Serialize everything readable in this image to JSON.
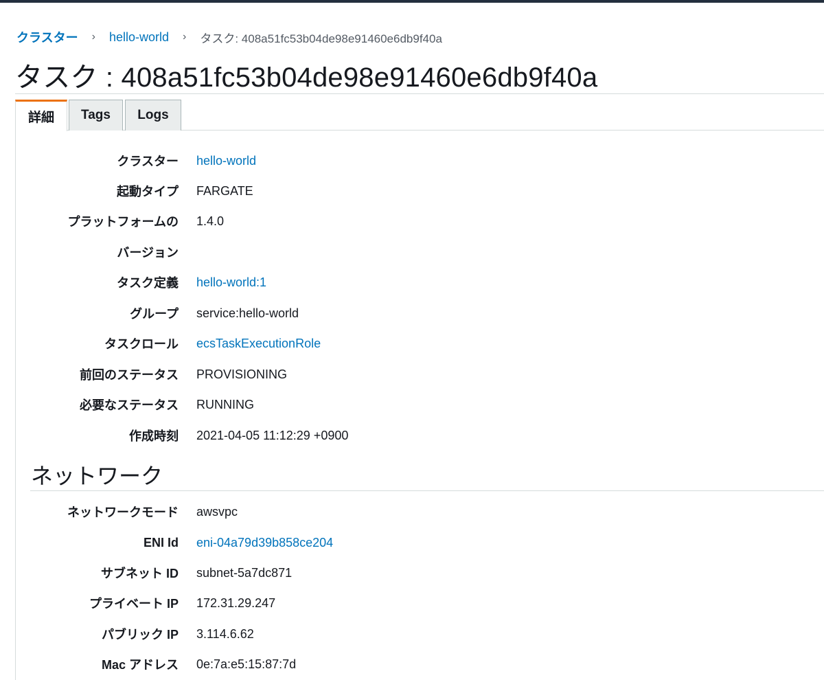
{
  "breadcrumb": {
    "items": [
      "クラスター",
      "hello-world"
    ],
    "current": "タスク: 408a51fc53b04de98e91460e6db9f40a",
    "separator": "›"
  },
  "page_title": "タスク : 408a51fc53b04de98e91460e6db9f40a",
  "tabs": [
    "詳細",
    "Tags",
    "Logs"
  ],
  "details": {
    "rows": [
      {
        "label": "クラスター",
        "value": "hello-world"
      },
      {
        "label": "起動タイプ",
        "value": "FARGATE"
      },
      {
        "label": "プラットフォームの",
        "value": "1.4.0"
      },
      {
        "label": "バージョン",
        "value": ""
      },
      {
        "label": "タスク定義",
        "value": "hello-world:1"
      },
      {
        "label": "グループ",
        "value": "service:hello-world"
      },
      {
        "label": "タスクロール",
        "value": "ecsTaskExecutionRole"
      },
      {
        "label": "前回のステータス",
        "value": "PROVISIONING"
      },
      {
        "label": "必要なステータス",
        "value": "RUNNING"
      },
      {
        "label": "作成時刻",
        "value": "2021-04-05 11:12:29 +0900"
      }
    ]
  },
  "network": {
    "title": "ネットワーク",
    "rows": [
      {
        "label": "ネットワークモード",
        "value": "awsvpc"
      },
      {
        "label": "ENI Id",
        "value": "eni-04a79d39b858ce204"
      },
      {
        "label": "サブネット ID",
        "value": "subnet-5a7dc871"
      },
      {
        "label": "プライベート IP",
        "value": "172.31.29.247"
      },
      {
        "label": "パブリック IP",
        "value": "3.114.6.62"
      },
      {
        "label": "Mac アドレス",
        "value": "0e:7a:e5:15:87:7d"
      }
    ]
  },
  "colors": {
    "link": "#0073bb",
    "tab_accent": "#ec7211",
    "header_bar": "#232f3e"
  }
}
